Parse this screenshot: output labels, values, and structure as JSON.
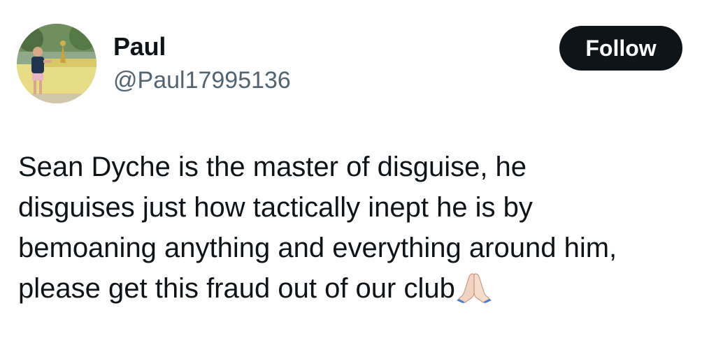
{
  "tweet": {
    "author": {
      "display_name": "Paul",
      "handle": "@Paul17995136",
      "avatar": "profile-photo"
    },
    "follow_label": "Follow",
    "text_lines": [
      "Sean Dyche is the master of disguise, he",
      "disguises just how tactically inept he is by",
      "bemoaning anything and everything around him,",
      "please get this fraud out of our club"
    ],
    "trailing_emoji": "folded-hands-emoji"
  },
  "colors": {
    "text": "#0f1419",
    "secondary_text": "#536471",
    "button_bg": "#0f1419",
    "button_text": "#ffffff",
    "background": "#ffffff"
  }
}
